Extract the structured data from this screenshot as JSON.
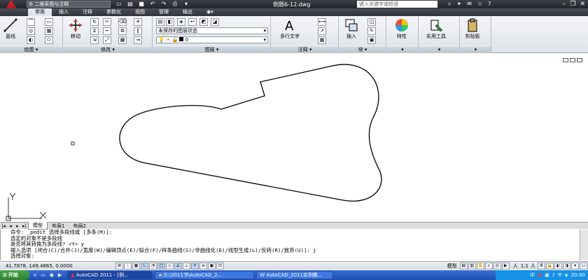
{
  "titlebar": {
    "workspace": "二维草图与注释",
    "doc_title": "例题6-12.dwg",
    "search_placeholder": "键入关键字或短语"
  },
  "ribbon_tabs": [
    "常用",
    "插入",
    "注释",
    "参数化",
    "视图",
    "管理",
    "输出"
  ],
  "ribbon": {
    "draw": {
      "line_label": "直线",
      "panel_label": "绘图"
    },
    "modify": {
      "move_label": "移动",
      "panel_label": "修改"
    },
    "layer": {
      "state": "未保存的图层状态",
      "current": "0",
      "panel_label": "图层"
    },
    "annotation": {
      "mtext_label": "多行文字",
      "panel_label": "注释"
    },
    "block": {
      "insert_label": "插入",
      "panel_label": "块"
    },
    "properties_label": "特性",
    "utilities_label": "实用工具",
    "clipboard_label": "剪贴板"
  },
  "ucs": {
    "x": "X",
    "y": "Y"
  },
  "layout_tabs": [
    "模型",
    "布局1",
    "布局2"
  ],
  "command_lines": [
    "命令:  _pedit 选择多段线或 [多条(M)]:",
    "选定的对象不是多段线",
    "是否将其转换为多段线? <Y> y",
    "输入选项 [闭合(C)/合并(J)/宽度(W)/编辑顶点(E)/拟合(F)/样条曲线(S)/非曲线化(D)/线型生成(L)/反转(R)/放弃(U)]: j",
    "选择对象:"
  ],
  "status": {
    "coords": "41.7878,  149.4865,  0.0000",
    "model_label": "模型",
    "scale": "1:1"
  },
  "taskbar": {
    "start": "开始",
    "tasks": [
      "AutoCAD 2011 - [例...",
      "D:\\2011书\\AutoCAD_2...",
      "AutoCAD_2011实例教..."
    ],
    "clock": "20:00"
  }
}
